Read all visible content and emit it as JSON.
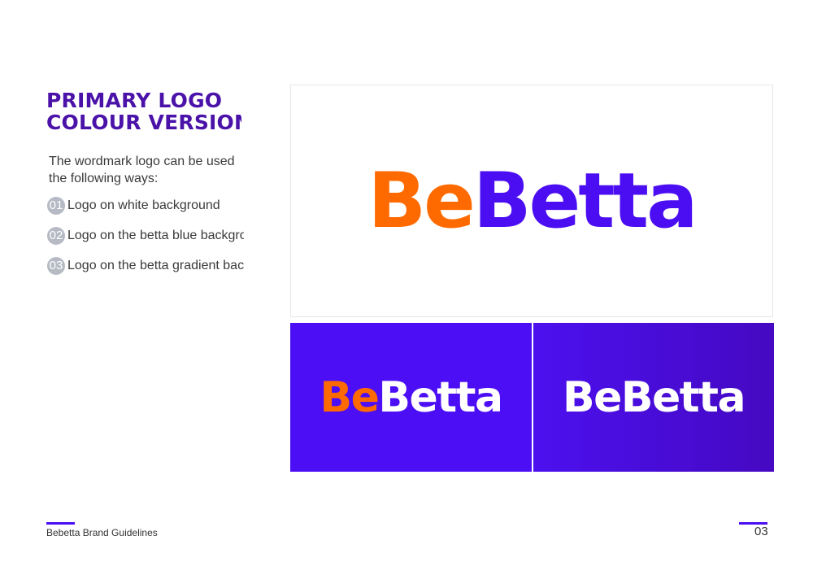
{
  "heading": {
    "line1": "PRIMARY LOGO",
    "line2": "COLOUR VERSION"
  },
  "intro": {
    "line1": "The wordmark logo can be used",
    "line2": "the following ways:"
  },
  "ways": [
    {
      "num": "01",
      "label": "Logo on white background"
    },
    {
      "num": "02",
      "label": "Logo on the betta blue background"
    },
    {
      "num": "03",
      "label": "Logo on the betta gradient background"
    }
  ],
  "logos": [
    {
      "part1": "Be",
      "part2": "Betta",
      "background": "white"
    },
    {
      "part1": "Be",
      "part2": "Betta",
      "background": "betta-blue"
    },
    {
      "part1": "Be",
      "part2": "Betta",
      "background": "betta-gradient"
    }
  ],
  "colors": {
    "heading": "#4a12a8",
    "betta_blue": "#4b0ef2",
    "orange": "#ff6a00",
    "gradient_end": "#4509c2"
  },
  "footer": {
    "label": "Bebetta Brand Guidelines",
    "page": "03"
  }
}
